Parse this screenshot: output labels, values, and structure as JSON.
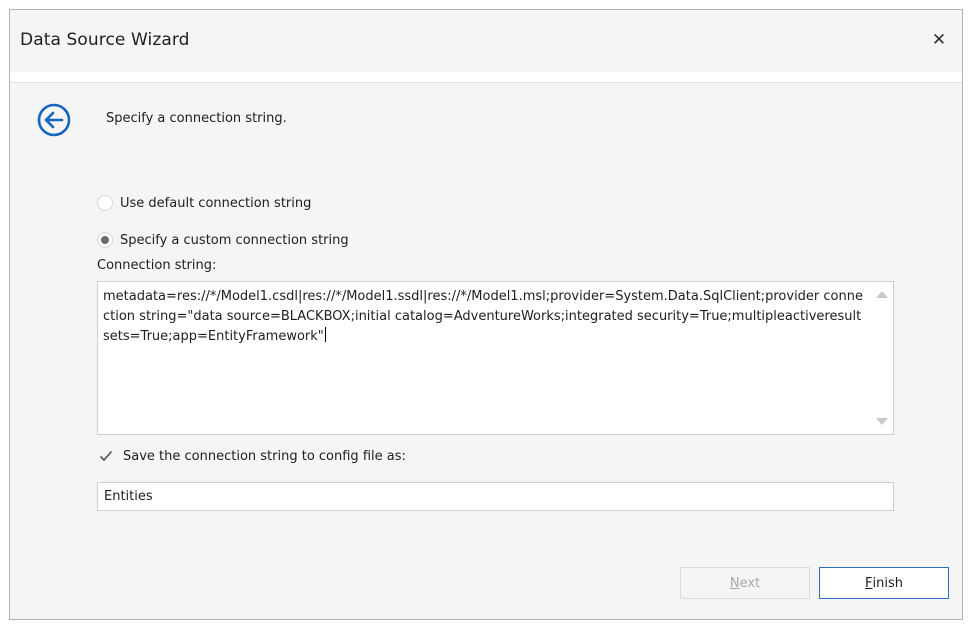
{
  "window": {
    "title": "Data Source Wizard"
  },
  "header": {
    "step_text": "Specify a connection string."
  },
  "options": {
    "default_label": "Use default connection string",
    "custom_label": "Specify a custom connection string",
    "selected": "custom"
  },
  "connection": {
    "label": "Connection string:",
    "value": "metadata=res://*/Model1.csdl|res://*/Model1.ssdl|res://*/Model1.msl;provider=System.Data.SqlClient;provider connection string=\"data source=BLACKBOX;initial catalog=AdventureWorks;integrated security=True;multipleactiveresultsets=True;app=EntityFramework\""
  },
  "save": {
    "checked": true,
    "label": "Save the connection string to config file as:",
    "name_value": "Entities"
  },
  "buttons": {
    "next": {
      "mnemonic": "N",
      "rest": "ext",
      "enabled": false
    },
    "finish": {
      "mnemonic": "F",
      "rest": "inish",
      "enabled": true
    }
  },
  "icons": {
    "back": "arrow-left-circle-icon",
    "close": "close-icon",
    "check": "checkmark-icon"
  },
  "colors": {
    "accent": "#1565c0",
    "button_border": "#2b6fc2"
  }
}
